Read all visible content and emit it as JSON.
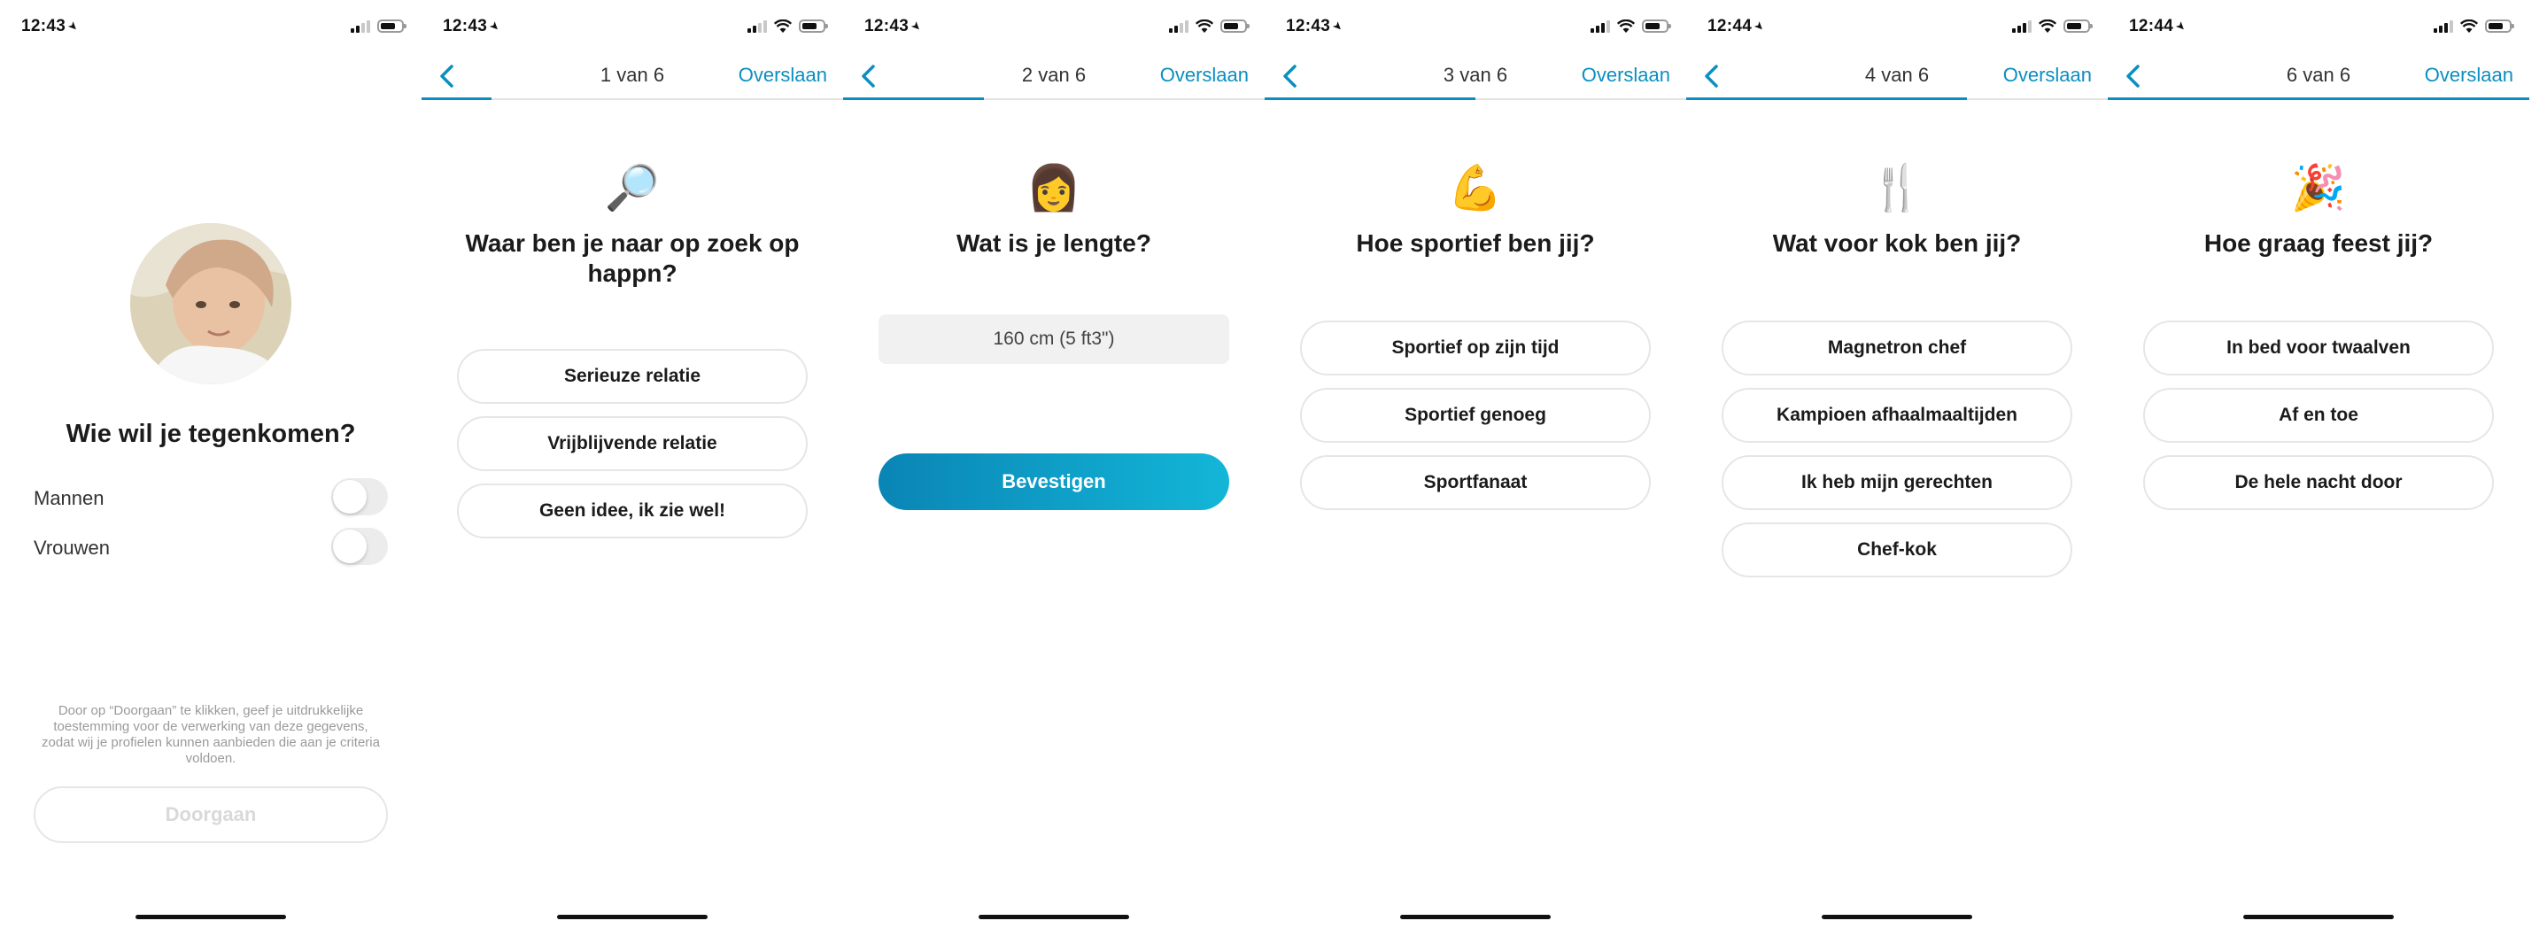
{
  "status_times": [
    "12:43",
    "12:43",
    "12:43",
    "12:43",
    "12:44",
    "12:44"
  ],
  "nav": {
    "skip_label": "Overslaan"
  },
  "panel1": {
    "title": "Wie wil je tegenkomen?",
    "toggles": [
      {
        "label": "Mannen",
        "on": false
      },
      {
        "label": "Vrouwen",
        "on": false
      }
    ],
    "consent": "Door op “Doorgaan” te klikken, geef je uitdrukkelijke toestemming voor de verwerking van deze gegevens, zodat wij je profielen kunnen aanbieden die aan je criteria voldoen.",
    "continue_label": "Doorgaan"
  },
  "panel2": {
    "step": "1 van 6",
    "progress": 0.167,
    "emoji": "🔎",
    "question": "Waar ben je naar op zoek op happn?",
    "options": [
      "Serieuze relatie",
      "Vrijblijvende relatie",
      "Geen idee, ik zie wel!"
    ]
  },
  "panel3": {
    "step": "2 van 6",
    "progress": 0.333,
    "emoji": "👩",
    "question": "Wat is je lengte?",
    "height_value": "160 cm (5 ft3\")",
    "confirm_label": "Bevestigen"
  },
  "panel4": {
    "step": "3 van 6",
    "progress": 0.5,
    "emoji": "💪",
    "question": "Hoe sportief ben jij?",
    "options": [
      "Sportief op zijn tijd",
      "Sportief genoeg",
      "Sportfanaat"
    ]
  },
  "panel5": {
    "step": "4 van 6",
    "progress": 0.667,
    "emoji": "🍴",
    "question": "Wat voor kok ben jij?",
    "options": [
      "Magnetron chef",
      "Kampioen afhaalmaaltijden",
      "Ik heb mijn gerechten",
      "Chef-kok"
    ]
  },
  "panel6": {
    "step": "6 van 6",
    "progress": 1.0,
    "emoji": "🎉",
    "question": "Hoe graag feest jij?",
    "options": [
      "In bed voor twaalven",
      "Af en toe",
      "De hele nacht door"
    ]
  },
  "colors": {
    "accent": "#0a8fc0",
    "button_gradient_start": "#0a85b5",
    "button_gradient_end": "#13b6d8",
    "toggle_off": "#ececec"
  },
  "icons": {
    "back": "chevron-left-icon",
    "location": "location-arrow-icon",
    "signal": "cellular-signal-icon",
    "wifi": "wifi-icon",
    "battery": "battery-icon"
  }
}
